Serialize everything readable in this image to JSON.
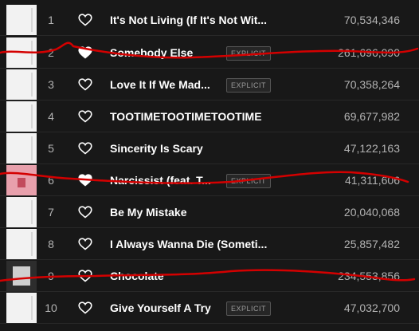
{
  "tracks": [
    {
      "rank": "1",
      "title": "It's Not Living (If It's Not Wit...",
      "explicit": "",
      "plays": "70,534,346"
    },
    {
      "rank": "2",
      "title": "Somebody Else",
      "explicit": "EXPLICIT",
      "plays": "261,696,090"
    },
    {
      "rank": "3",
      "title": "Love It If We Mad...",
      "explicit": "EXPLICIT",
      "plays": "70,358,264"
    },
    {
      "rank": "4",
      "title": "TOOTIMETOOTIMETOOTIME",
      "explicit": "",
      "plays": "69,677,982"
    },
    {
      "rank": "5",
      "title": "Sincerity Is Scary",
      "explicit": "",
      "plays": "47,122,163"
    },
    {
      "rank": "6",
      "title": "Narcissist (feat. T...",
      "explicit": "EXPLICIT",
      "plays": "41,311,606"
    },
    {
      "rank": "7",
      "title": "Be My Mistake",
      "explicit": "",
      "plays": "20,040,068"
    },
    {
      "rank": "8",
      "title": "I Always Wanna Die (Someti...",
      "explicit": "",
      "plays": "25,857,482"
    },
    {
      "rank": "9",
      "title": "Chocolate",
      "explicit": "",
      "plays": "234,553,856"
    },
    {
      "rank": "10",
      "title": "Give Yourself A Try",
      "explicit": "EXPLICIT",
      "plays": "47,032,700"
    }
  ],
  "icons": {
    "like": "heart-outline-icon"
  },
  "colors": {
    "background": "#181818",
    "annotation": "#d40000"
  }
}
